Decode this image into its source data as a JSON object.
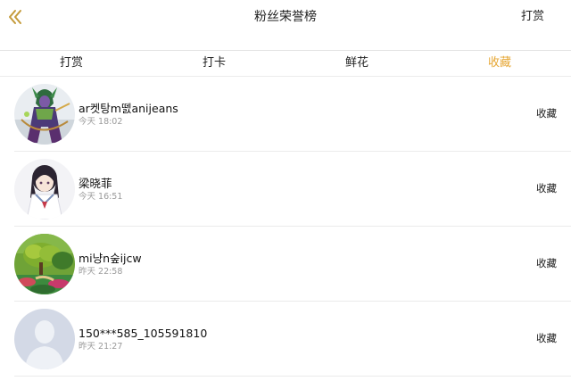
{
  "header": {
    "back_icon": "chevron-left-icon",
    "title": "粉丝荣誉榜",
    "action_label": "打赏"
  },
  "tabs": [
    {
      "label": "打赏",
      "active": false
    },
    {
      "label": "打卡",
      "active": false
    },
    {
      "label": "鲜花",
      "active": false
    },
    {
      "label": "收藏",
      "active": true
    }
  ],
  "colors": {
    "accent": "#e6a735",
    "divider": "#ebebeb",
    "secondary_text": "#9a9a9a"
  },
  "fans": [
    {
      "name": "ar켓탕m뗈anijeans",
      "time": "今天 18:02",
      "action": "收藏",
      "avatar": "warrior-character-avatar"
    },
    {
      "name": "梁晓菲",
      "time": "今天 16:51",
      "action": "收藏",
      "avatar": "anime-girl-avatar"
    },
    {
      "name": "mi냥n숲ijcw",
      "time": "昨天 22:58",
      "action": "收藏",
      "avatar": "garden-landscape-avatar"
    },
    {
      "name": "150***585_105591810",
      "time": "昨天 21:27",
      "action": "收藏",
      "avatar": "default-person-avatar"
    }
  ]
}
